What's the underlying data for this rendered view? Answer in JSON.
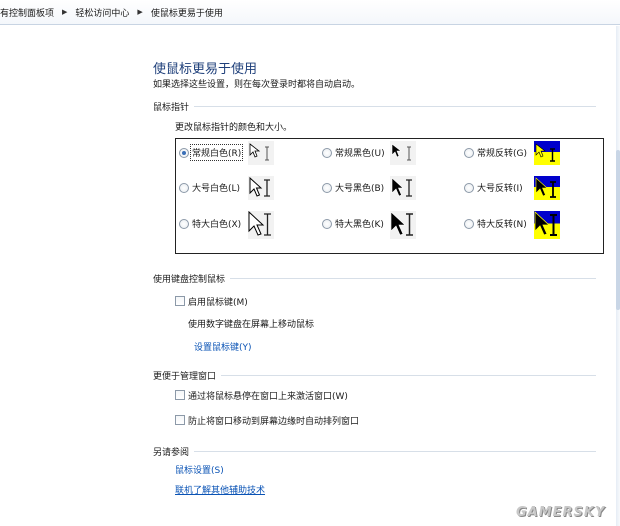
{
  "breadcrumb": {
    "items": [
      "有控制面板项",
      "轻松访问中心",
      "使鼠标更易于使用"
    ]
  },
  "header": {
    "title": "使鼠标更易于使用",
    "subtitle": "如果选择这些设置，则在每次登录时都将自动启动。"
  },
  "pointers": {
    "heading": "鼠标指针",
    "description": "更改鼠标指针的颜色和大小。",
    "options": [
      {
        "label": "常规白色(R)",
        "color": "white",
        "size": "regular",
        "selected": true
      },
      {
        "label": "常规黑色(U)",
        "color": "black",
        "size": "regular",
        "selected": false
      },
      {
        "label": "常规反转(G)",
        "color": "inverted",
        "size": "regular",
        "selected": false
      },
      {
        "label": "大号白色(L)",
        "color": "white",
        "size": "large",
        "selected": false
      },
      {
        "label": "大号黑色(B)",
        "color": "black",
        "size": "large",
        "selected": false
      },
      {
        "label": "大号反转(I)",
        "color": "inverted",
        "size": "large",
        "selected": false
      },
      {
        "label": "特大白色(X)",
        "color": "white",
        "size": "xlarge",
        "selected": false
      },
      {
        "label": "特大黑色(K)",
        "color": "black",
        "size": "xlarge",
        "selected": false
      },
      {
        "label": "特大反转(N)",
        "color": "inverted",
        "size": "xlarge",
        "selected": false
      }
    ]
  },
  "keyboard": {
    "heading": "使用键盘控制鼠标",
    "mousekeys_label": "启用鼠标键(M)",
    "mousekeys_checked": false,
    "mousekeys_desc": "使用数字键盘在屏幕上移动鼠标",
    "setup_link": "设置鼠标键(Y)"
  },
  "windows": {
    "heading": "更便于管理窗口",
    "hover_activate_label": "通过将鼠标悬停在窗口上来激活窗口(W)",
    "hover_activate_checked": false,
    "prevent_arrange_label": "防止将窗口移动到屏幕边缘时自动排列窗口",
    "prevent_arrange_checked": false
  },
  "see_also": {
    "heading": "另请参阅",
    "links": [
      "鼠标设置(S)",
      "联机了解其他辅助技术"
    ]
  },
  "watermark": "GAMERSKY",
  "colors": {
    "title": "#1e3f7a",
    "link": "#0a53b5",
    "inverted_blue": "#0000cc",
    "inverted_yellow": "#ffff00"
  }
}
